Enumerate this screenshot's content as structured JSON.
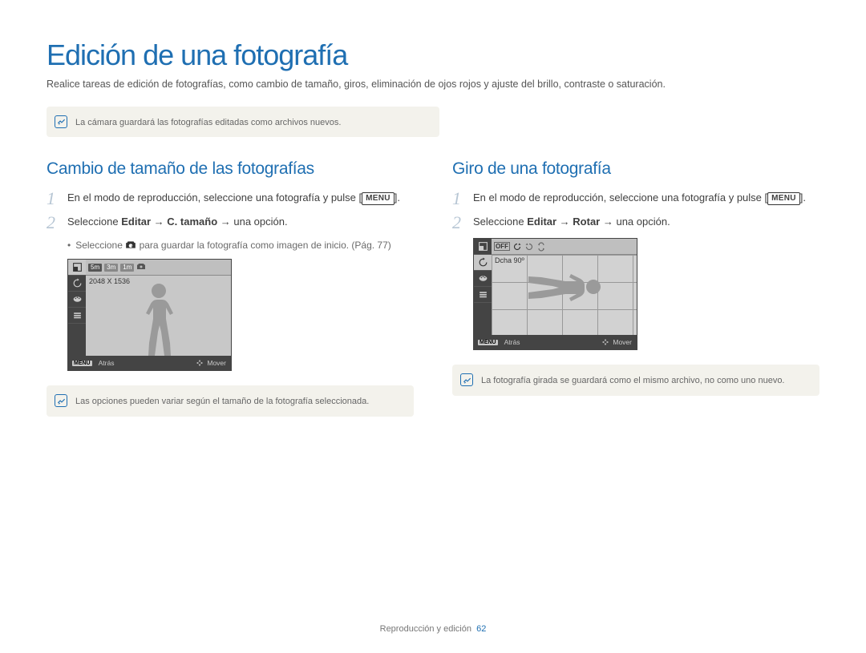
{
  "title": "Edición de una fotografía",
  "intro": "Realice tareas de edición de fotografías, como cambio de tamaño, giros, eliminación de ojos rojos y ajuste del brillo, contraste o saturación.",
  "topNote": "La cámara guardará las fotografías editadas como archivos nuevos.",
  "menuLabel": "MENU",
  "left": {
    "heading": "Cambio de tamaño de las fotografías",
    "step1a": "En el modo de reproducción, seleccione una fotografía y pulse [",
    "step1b": "].",
    "step2a": "Seleccione ",
    "step2b": "Editar",
    "step2c": " → ",
    "step2d": "C. tamaño",
    "step2e": " → una opción.",
    "bullet_a": "Seleccione ",
    "bullet_b": " para guardar la fotografía como imagen de inicio. (Pág. 77)",
    "ss_chip1": "5m",
    "ss_chip2": "3m",
    "ss_chip3": "1m",
    "ss_sublabel": "2048 X 1536",
    "ss_back": "Atrás",
    "ss_move": "Mover",
    "note": "Las opciones pueden variar según el tamaño de la fotografía seleccionada."
  },
  "right": {
    "heading": "Giro de una fotografía",
    "step1a": "En el modo de reproducción, seleccione una fotografía y pulse [",
    "step1b": "].",
    "step2a": "Seleccione ",
    "step2b": "Editar",
    "step2c": " → ",
    "step2d": "Rotar",
    "step2e": " → una opción.",
    "ss_sublabel": "Dcha 90º",
    "ss_back": "Atrás",
    "ss_move": "Mover",
    "note": "La fotografía girada se guardará como el mismo archivo, no como uno nuevo."
  },
  "footer": {
    "section": "Reproducción y edición",
    "page": "62"
  }
}
